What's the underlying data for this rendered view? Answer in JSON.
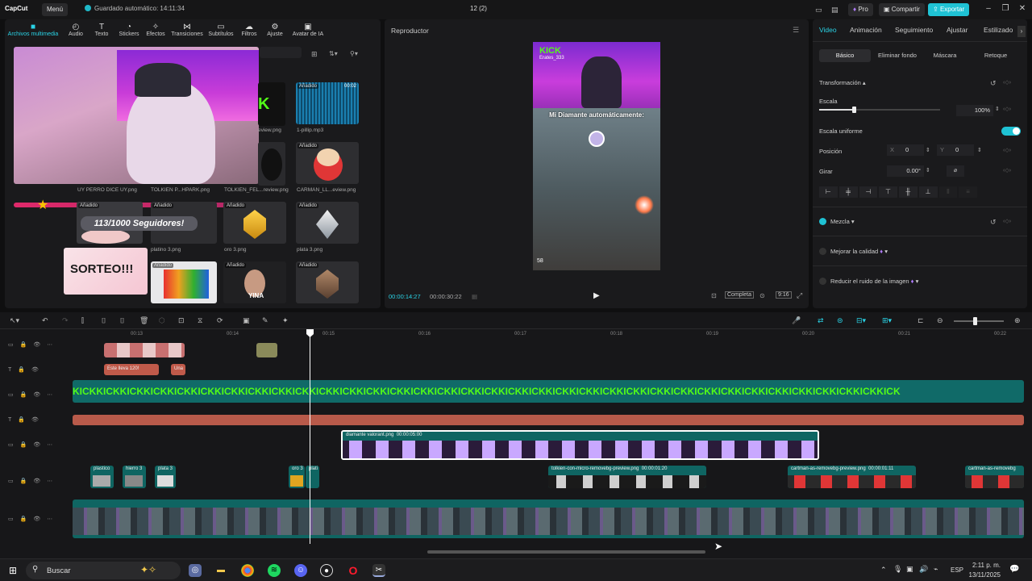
{
  "topbar": {
    "logo": "CapCut",
    "menu": "Menú",
    "autosave": "Guardado automático: 14:11:34",
    "project_name": "12 (2)",
    "pro": "Pro",
    "share": "Compartir",
    "export": "Exportar"
  },
  "toolbar": {
    "items": [
      "Archivos multimedia",
      "Audio",
      "Texto",
      "Stickers",
      "Efectos",
      "Transiciones",
      "Subtítulos",
      "Filtros",
      "Ajuste",
      "Avatar de IA"
    ]
  },
  "media": {
    "added": "Añadido",
    "duration_1": "00:02",
    "row1": [
      "eview.png",
      "1-pillip.mp3"
    ],
    "row2": [
      "UY PERRO DICE UY.png",
      "TOLKIEN P...HPARK.png",
      "TOLKIEN_FEL...review.png",
      "CARMAN_LL...eview.png"
    ],
    "row3": [
      "platino 3.png",
      "oro 3.png",
      "plata 3.png"
    ],
    "overlay_text": "113/1000 Seguidores!",
    "sorteo_text": "SORTEO!!!",
    "yina_text": "YINA"
  },
  "player": {
    "title": "Reproductor",
    "current_time": "00:00:14:27",
    "total_time": "00:00:30:22",
    "ratio_label": "Completa",
    "aspect_label": "9:16",
    "preview_kick": "KICK",
    "preview_user": "Erates_333",
    "preview_caption": "Mi Diamante automáticamente:",
    "preview_hud": "58"
  },
  "right_panel": {
    "tabs": [
      "Video",
      "Animación",
      "Seguimiento",
      "Ajustar",
      "Estilizado"
    ],
    "subtabs": [
      "Básico",
      "Eliminar fondo",
      "Máscara",
      "Retoque"
    ],
    "transform": "Transformación",
    "scale": "Escala",
    "scale_value": "100%",
    "scale_fraction": 0.1,
    "uniform_scale": "Escala uniforme",
    "position": "Posición",
    "x_label": "X",
    "x_value": "0",
    "y_label": "Y",
    "y_value": "0",
    "rotate": "Girar",
    "rotate_value": "0.00°",
    "blend": "Mezcla",
    "enhance": "Mejorar la calidad",
    "denoise": "Reducir el ruido de la imagen"
  },
  "timeline": {
    "ruler": [
      "00:13",
      "00:14",
      "00:15",
      "00:16",
      "00:17",
      "00:18",
      "00:19",
      "00:20",
      "00:21",
      "00:22"
    ],
    "text_clips": [
      "Este lleva 120!",
      "Una"
    ],
    "kick_strip": "KICKKICKKICKKICKKICKKICKKICKKICKKICKKICKKICKKICKKICKKICKKICKKICKKICKKICKKICKKICKKICKKICKKICKKICKKICKKICKKICKKICKKICKKICKKICKKICKKICKKICKKICK",
    "diamond_clip": "diamante valorant.png",
    "diamond_duration": "00:00:05:00",
    "small_clips": [
      "plastico",
      "hierro 3",
      "plata 3",
      "oro 3",
      "plati"
    ],
    "tolkien_clip": "tolkien-con-micro-removebg-preview.png",
    "tolkien_duration": "00:00:01:20",
    "cartman_clip": "cartman-as-removebg-preview.png",
    "cartman_duration": "00:00:01:11",
    "cartman_clip_2": "cartman-as-removebg"
  },
  "taskbar": {
    "search": "Buscar",
    "lang": "ESP",
    "time": "2:11 p. m.",
    "date": "13/11/2025"
  }
}
